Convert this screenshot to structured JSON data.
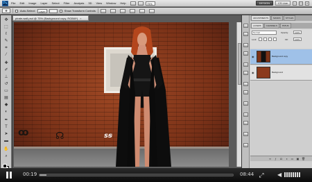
{
  "app": {
    "menu_items": [
      "File",
      "Edit",
      "Image",
      "Layer",
      "Select",
      "Filter",
      "Analysis",
      "3D",
      "View",
      "Window",
      "Help"
    ],
    "zoom_field": "75%",
    "workspace_button": "DESIGN",
    "cs_live": "CS Live"
  },
  "options_bar": {
    "auto_select_label": "Auto-Select:",
    "auto_select_value": "Layer",
    "show_transform_label": "Show Transform Controls"
  },
  "document": {
    "tab_title": "pirate-wall.psd @ 75% (Background copy, RGB/8*)",
    "tab_close": "×"
  },
  "panels": {
    "top_tabs": [
      "ADJUSTMENTS",
      "MASKS",
      "STYLES"
    ],
    "layer_tabs": [
      "LAYERS",
      "CHANNELS",
      "PATHS"
    ],
    "blend_mode": "Normal",
    "opacity_label": "Opacity:",
    "opacity_value": "100%",
    "lock_label": "Lock:",
    "fill_label": "Fill:",
    "fill_value": "100%",
    "layers": [
      {
        "name": "Background copy",
        "active": true
      },
      {
        "name": "Background",
        "active": false
      }
    ]
  },
  "player": {
    "current_time": "00:19",
    "total_time": "08:44",
    "progress": 0.037
  }
}
